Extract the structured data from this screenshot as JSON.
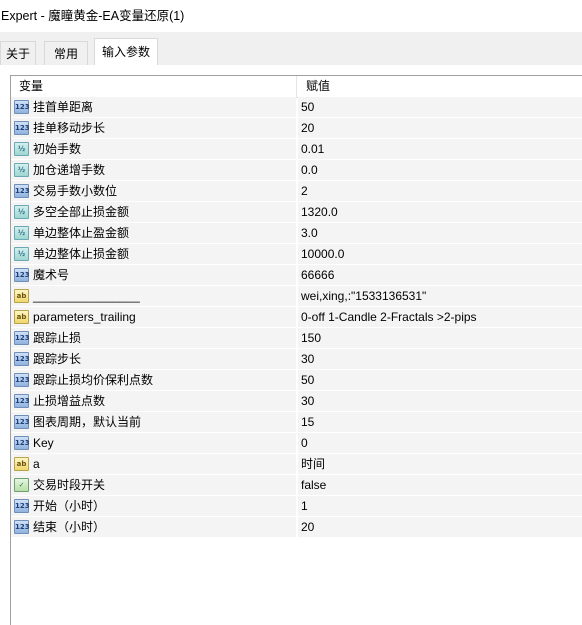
{
  "window": {
    "title": "Expert - 魔瞳黄金-EA变量还原(1)"
  },
  "tabs": [
    {
      "label": "关于"
    },
    {
      "label": "常用"
    },
    {
      "label": "输入参数"
    }
  ],
  "grid": {
    "columns": [
      "变量",
      "赋值"
    ],
    "rows": [
      {
        "type": "int",
        "icon": "int-icon",
        "icon_text": "123",
        "name": "挂首单距离",
        "value": "50"
      },
      {
        "type": "int",
        "icon": "int-icon",
        "icon_text": "123",
        "name": "挂单移动步长",
        "value": "20"
      },
      {
        "type": "dbl",
        "icon": "double-icon",
        "icon_text": "½",
        "name": "初始手数",
        "value": "0.01"
      },
      {
        "type": "dbl",
        "icon": "double-icon",
        "icon_text": "½",
        "name": "加仓递增手数",
        "value": "0.0"
      },
      {
        "type": "int",
        "icon": "int-icon",
        "icon_text": "123",
        "name": "交易手数小数位",
        "value": "2"
      },
      {
        "type": "dbl",
        "icon": "double-icon",
        "icon_text": "½",
        "name": "多空全部止损金额",
        "value": "1320.0"
      },
      {
        "type": "dbl",
        "icon": "double-icon",
        "icon_text": "½",
        "name": "单边整体止盈金额",
        "value": "3.0"
      },
      {
        "type": "dbl",
        "icon": "double-icon",
        "icon_text": "½",
        "name": "单边整体止损金额",
        "value": "10000.0"
      },
      {
        "type": "int",
        "icon": "int-icon",
        "icon_text": "123",
        "name": "魔术号",
        "value": "66666"
      },
      {
        "type": "str",
        "icon": "string-icon",
        "icon_text": "ab",
        "name": "________________",
        "value": "wei,xing,:\"1533136531\""
      },
      {
        "type": "str",
        "icon": "string-icon",
        "icon_text": "ab",
        "name": "parameters_trailing",
        "value": "0-off  1-Candle  2-Fractals  >2-pips"
      },
      {
        "type": "int",
        "icon": "int-icon",
        "icon_text": "123",
        "name": "跟踪止损",
        "value": "150"
      },
      {
        "type": "int",
        "icon": "int-icon",
        "icon_text": "123",
        "name": "跟踪步长",
        "value": "30"
      },
      {
        "type": "int",
        "icon": "int-icon",
        "icon_text": "123",
        "name": "跟踪止损均价保利点数",
        "value": "50"
      },
      {
        "type": "int",
        "icon": "int-icon",
        "icon_text": "123",
        "name": "止损增益点数",
        "value": "30"
      },
      {
        "type": "int",
        "icon": "int-icon",
        "icon_text": "123",
        "name": "图表周期，默认当前",
        "value": "15"
      },
      {
        "type": "int",
        "icon": "int-icon",
        "icon_text": "123",
        "name": "Key",
        "value": "0"
      },
      {
        "type": "str",
        "icon": "string-icon",
        "icon_text": "ab",
        "name": "a",
        "value": "时间"
      },
      {
        "type": "bool",
        "icon": "bool-icon",
        "icon_text": "✓",
        "name": "交易时段开关",
        "value": "false"
      },
      {
        "type": "int",
        "icon": "int-icon",
        "icon_text": "123",
        "name": "开始（小时）",
        "value": "1"
      },
      {
        "type": "int",
        "icon": "int-icon",
        "icon_text": "123",
        "name": "结束（小时）",
        "value": "20"
      }
    ]
  }
}
